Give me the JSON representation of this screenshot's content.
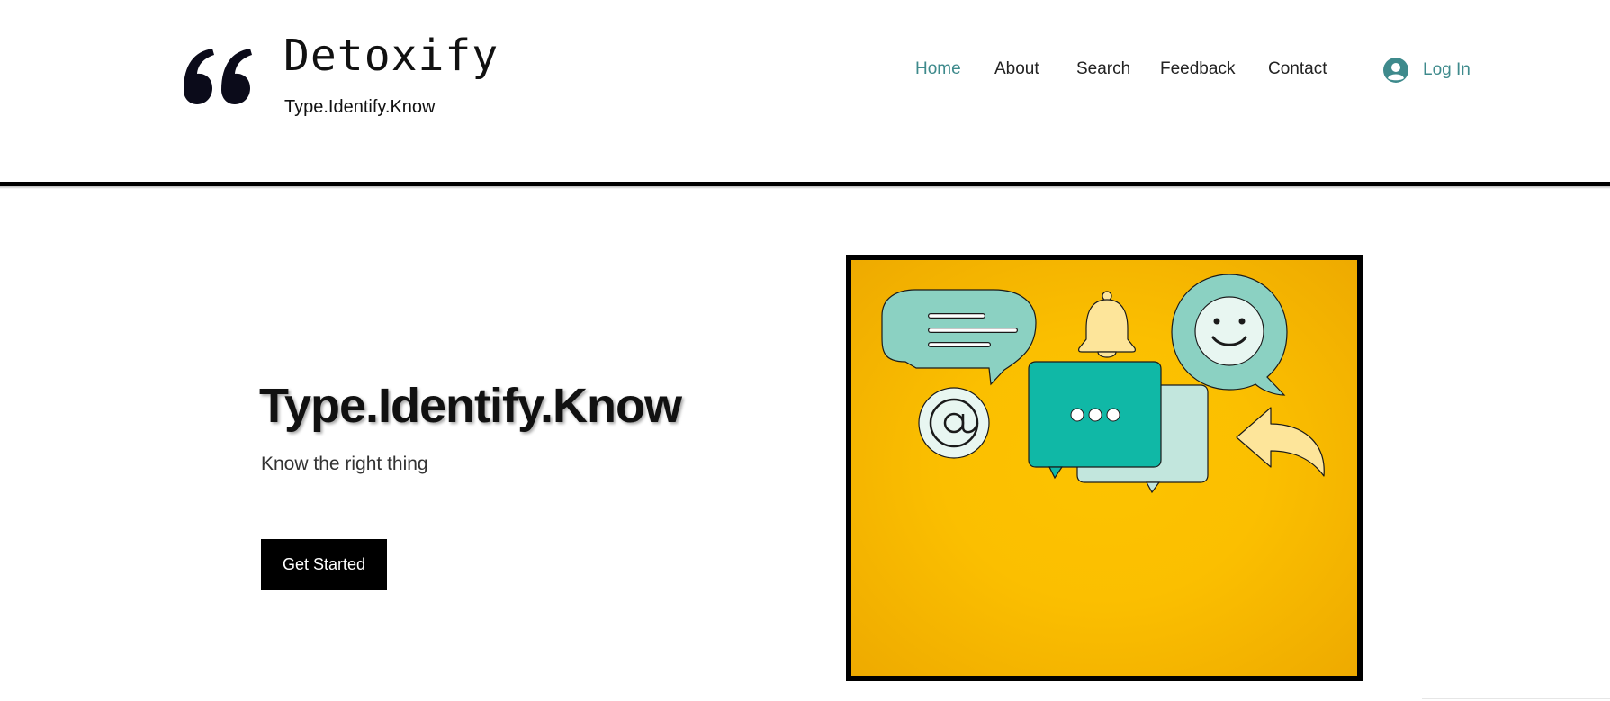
{
  "brand": {
    "name": "Detoxify",
    "tagline": "Type.Identify.Know",
    "logo_icon": "quote-mark-icon"
  },
  "nav": {
    "items": [
      {
        "label": "Home",
        "active": true
      },
      {
        "label": "About",
        "active": false
      },
      {
        "label": "Search",
        "active": false
      },
      {
        "label": "Feedback",
        "active": false
      },
      {
        "label": "Contact",
        "active": false
      }
    ],
    "login_label": "Log In",
    "login_icon": "user-avatar-icon"
  },
  "hero": {
    "title": "Type.Identify.Know",
    "subtitle": "Know the right thing",
    "cta_label": "Get Started"
  },
  "illustration": {
    "background": "#fbbf00",
    "icons": [
      "chat-bubble-lines-icon",
      "bell-icon",
      "smiley-bubble-icon",
      "at-sign-icon",
      "typing-bubble-icon",
      "reply-arrow-icon"
    ]
  },
  "colors": {
    "accent": "#3e8a8c",
    "mint": "#8bd1c2",
    "teal": "#10b8a6",
    "pale_mint": "#c2e6dd",
    "pale_yellow": "#fde59a",
    "yellow": "#fbbf00"
  }
}
